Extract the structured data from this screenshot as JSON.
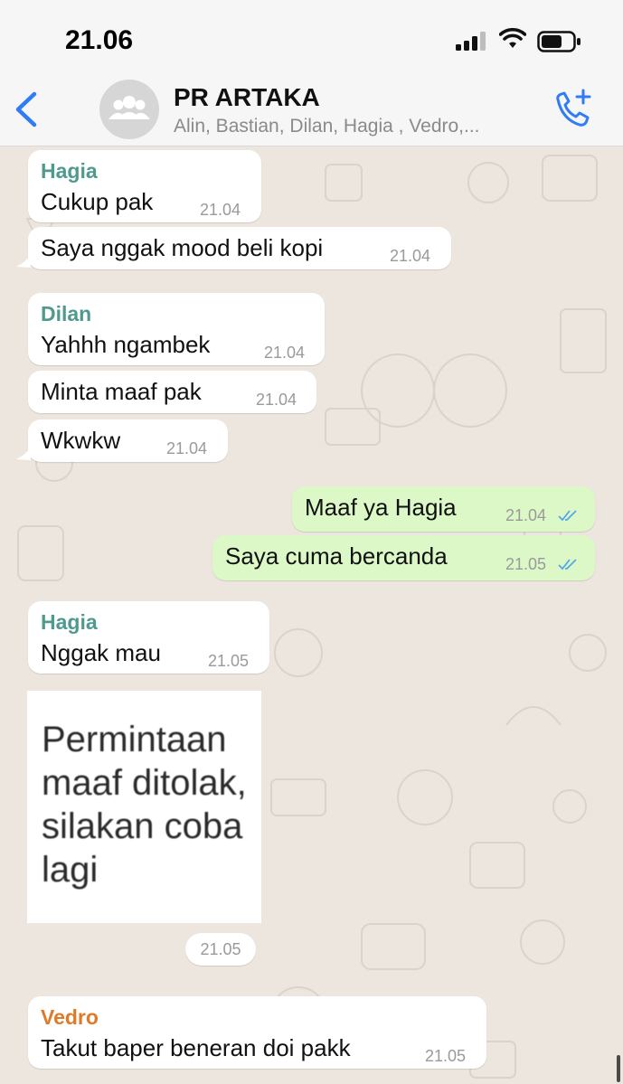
{
  "status_bar": {
    "time": "21.06"
  },
  "header": {
    "title": "PR ARTAKA",
    "subtitle": "Alin, Bastian, Dilan, Hagia , Vedro,..."
  },
  "colors": {
    "hagia": "#4f9a8f",
    "dilan": "#4f9a8f",
    "vedro": "#e07a26",
    "outgoing": "#dcf8c6",
    "accent": "#2f7cf6"
  },
  "messages": [
    {
      "sender": "Hagia",
      "text": "Cukup pak",
      "time": "21.04"
    },
    {
      "text": "Saya nggak mood beli kopi",
      "time": "21.04"
    },
    {
      "sender": "Dilan",
      "text": "Yahhh ngambek",
      "time": "21.04"
    },
    {
      "text": "Minta maaf pak",
      "time": "21.04"
    },
    {
      "text": "Wkwkw",
      "time": "21.04"
    },
    {
      "text": "Maaf ya Hagia",
      "time": "21.04",
      "outgoing": true
    },
    {
      "text": "Saya cuma bercanda",
      "time": "21.05",
      "outgoing": true
    },
    {
      "sender": "Hagia",
      "text": "Nggak mau",
      "time": "21.05"
    },
    {
      "sender": "Vedro",
      "text": "Takut baper beneran doi pakk",
      "time": "21.05"
    }
  ],
  "sticker": {
    "text": "Permintaan maaf ditolak, silakan coba lagi",
    "time": "21.05"
  }
}
